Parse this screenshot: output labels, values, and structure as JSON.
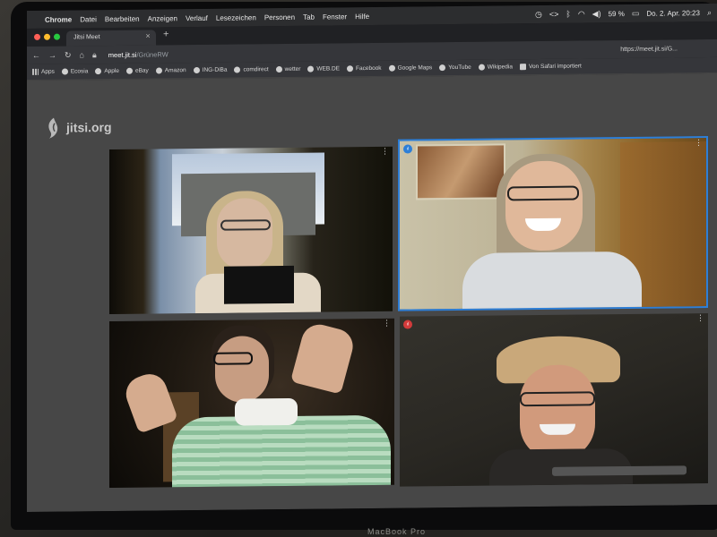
{
  "colors": {
    "menubar": "#2c2d2f",
    "tabbar": "#202124",
    "jitsi_background": "#474747",
    "active_speaker_border": "#2d7fd8",
    "traffic_red": "#ff5f57",
    "traffic_yellow": "#febc2e",
    "traffic_green": "#28c840"
  },
  "menubar": {
    "app_name": "Chrome",
    "items": [
      "Datei",
      "Bearbeiten",
      "Anzeigen",
      "Verlauf",
      "Lesezeichen",
      "Personen",
      "Tab",
      "Fenster",
      "Hilfe"
    ],
    "battery": "59 %",
    "datetime": "Do. 2. Apr.  20:23"
  },
  "tab": {
    "title": "Jitsi Meet"
  },
  "address": {
    "host": "meet.jit.si",
    "path": "/GrüneRW",
    "extension_url": "https://meet.jit.si/G..."
  },
  "bookmarks": [
    "Apps",
    "Ecosia",
    "Apple",
    "eBay",
    "Amazon",
    "ING-DiBa",
    "comdirect",
    "wetter",
    "WEB.DE",
    "Facebook",
    "Google Maps",
    "YouTube",
    "Wikipedia",
    "Von Safari importiert"
  ],
  "jitsi": {
    "logo_text": "jitsi.org"
  },
  "tiles": [
    {
      "id": "participant-1",
      "active": false,
      "badge": ""
    },
    {
      "id": "participant-2",
      "active": true,
      "badge": "connection-good"
    },
    {
      "id": "participant-3",
      "active": false,
      "badge": ""
    },
    {
      "id": "participant-4",
      "active": false,
      "badge": "connection-poor"
    }
  ],
  "laptop_brand": "MacBook Pro"
}
